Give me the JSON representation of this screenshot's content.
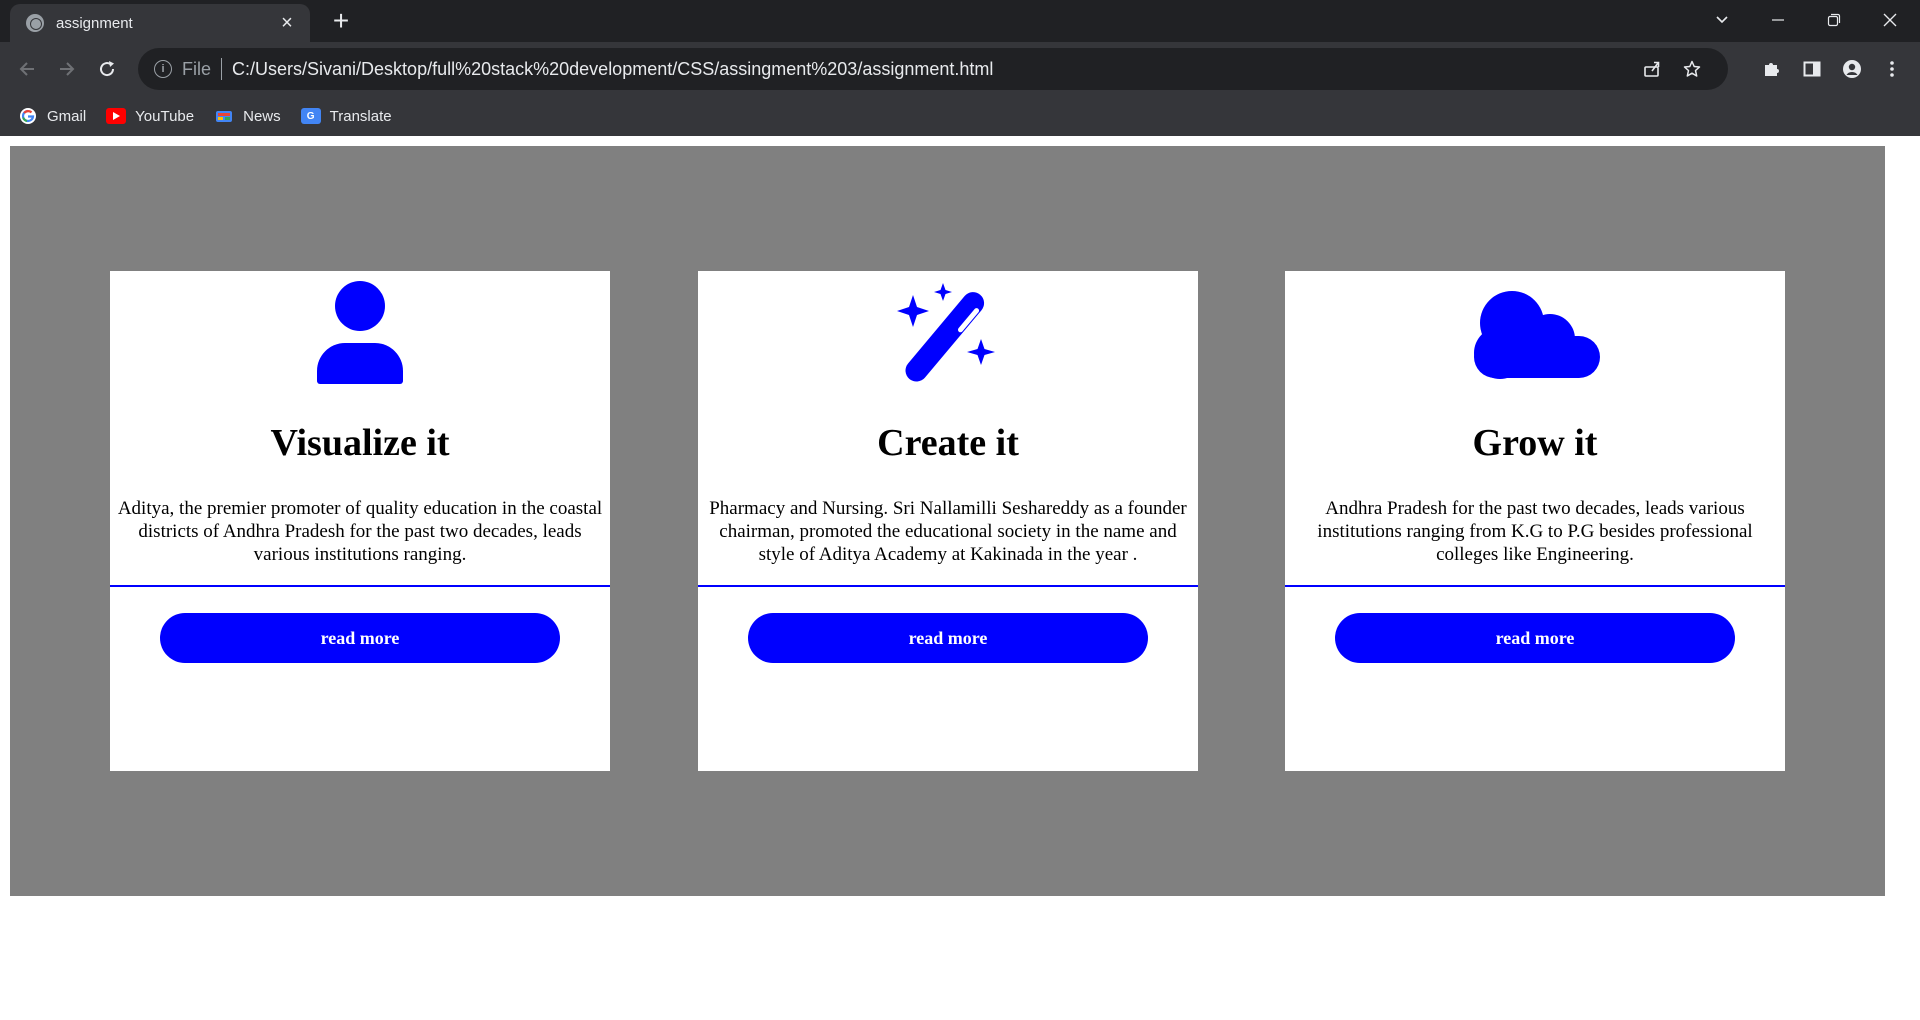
{
  "browser": {
    "tab_title": "assignment",
    "url_scheme": "File",
    "url": "C:/Users/Sivani/Desktop/full%20stack%20development/CSS/assingment%203/assignment.html"
  },
  "bookmarks": [
    {
      "label": "Gmail",
      "icon": "google-icon"
    },
    {
      "label": "YouTube",
      "icon": "youtube-icon"
    },
    {
      "label": "News",
      "icon": "news-icon"
    },
    {
      "label": "Translate",
      "icon": "translate-icon"
    }
  ],
  "colors": {
    "accent": "#0000ff",
    "section_bg": "#808080",
    "card_bg": "#ffffff"
  },
  "cards": [
    {
      "icon": "user-icon",
      "title": "Visualize it",
      "text": "Aditya, the premier promoter of quality education in the coastal districts of Andhra Pradesh for the past two decades, leads various institutions ranging.",
      "button": "read more"
    },
    {
      "icon": "magic-wand-icon",
      "title": "Create it",
      "text": "Pharmacy and Nursing. Sri Nallamilli Seshareddy as a founder chairman, promoted the educational society in the name and style of Aditya Academy at Kakinada in the year .",
      "button": "read more"
    },
    {
      "icon": "cloud-icon",
      "title": "Grow it",
      "text": "Andhra Pradesh for the past two decades, leads various institutions ranging from K.G to P.G besides professional colleges like Engineering.",
      "button": "read more"
    }
  ]
}
